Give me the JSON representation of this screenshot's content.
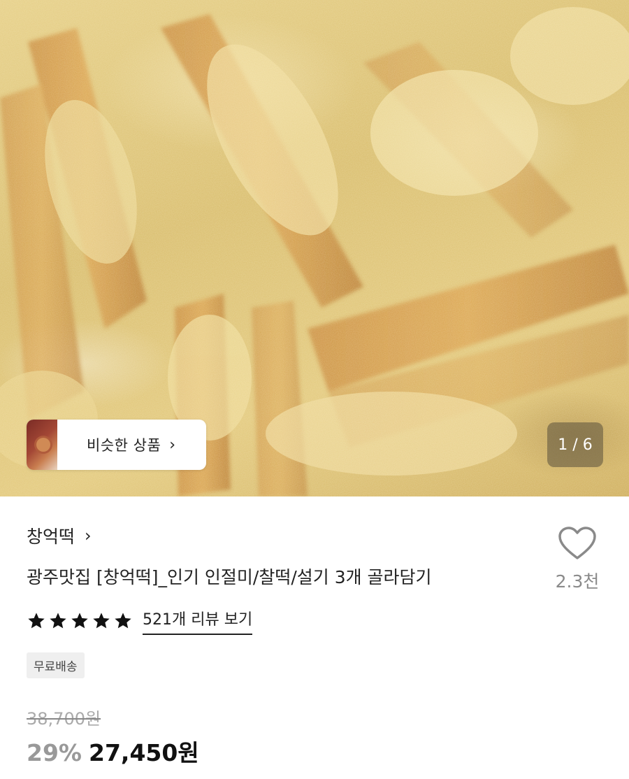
{
  "hero": {
    "image_alt": "",
    "similar_products_label": "비슷한 상품",
    "page_counter": "1 / 6"
  },
  "product": {
    "brand": "창억떡",
    "title": "광주맛집 [창억떡]_인기 인절미/찰떡/설기 3개 골라담기",
    "rating_stars": 5,
    "review_link": "521개 리뷰 보기",
    "badge": "무료배송",
    "original_price": "38,700원",
    "discount": "29%",
    "price": "27,450원"
  },
  "wishlist": {
    "count": "2.3천"
  },
  "icons": {
    "chevron": "chevron-right-icon",
    "heart": "heart-outline-icon",
    "star": "star-filled-icon"
  }
}
